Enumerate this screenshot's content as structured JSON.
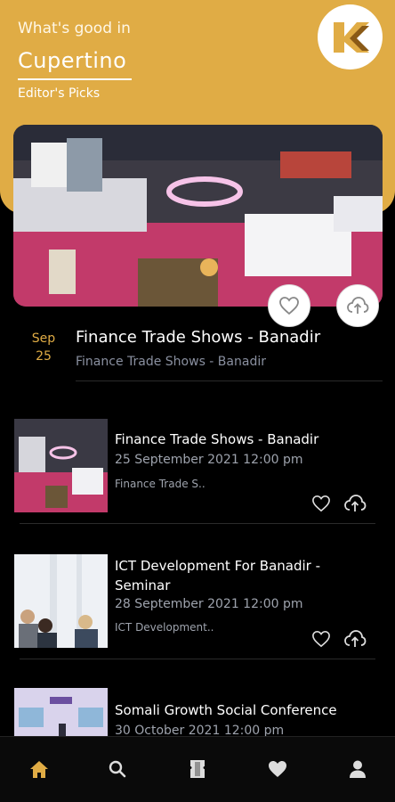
{
  "header": {
    "greeting": "What's good in",
    "city": "Cupertino",
    "section": "Editor's Picks",
    "accent": "#e0ac45"
  },
  "featured": {
    "month": "Sep",
    "day": "25",
    "title": "Finance Trade Shows - Banadir",
    "subtitle": "Finance Trade Shows - Banadir",
    "icons": [
      "heart-icon",
      "cloud-upload-icon"
    ]
  },
  "events": [
    {
      "title": "Finance Trade Shows - Banadir",
      "date": "25 September 2021 12:00 pm",
      "snippet": "Finance Trade S.."
    },
    {
      "title": "ICT Development For Banadir - Seminar",
      "date": "28 September 2021 12:00 pm",
      "snippet": "ICT Development.."
    },
    {
      "title": "Somali Growth Social Conference",
      "date": "30 October 2021 12:00 pm",
      "snippet": ""
    }
  ],
  "tabbar": {
    "items": [
      "home-icon",
      "search-icon",
      "ticket-icon",
      "heart-icon",
      "profile-icon"
    ],
    "active": "home-icon"
  }
}
